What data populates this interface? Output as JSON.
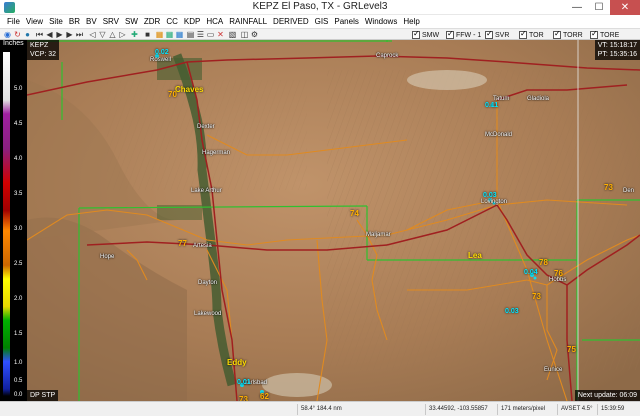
{
  "window": {
    "title": "KEPZ El Paso, TX - GRLevel3",
    "minimize": "—",
    "maximize": "☐",
    "close": "✕"
  },
  "menu": [
    "File",
    "View",
    "Site",
    "BR",
    "BV",
    "SRV",
    "SW",
    "ZDR",
    "CC",
    "KDP",
    "HCA",
    "RAINFALL",
    "DERIVED",
    "GIS",
    "Panels",
    "Windows",
    "Help"
  ],
  "toolbar": {
    "checks": [
      {
        "label": "SMW",
        "checked": true
      },
      {
        "label": "FFW - 1",
        "checked": true
      },
      {
        "label": "SVR",
        "checked": true
      },
      {
        "label": "TOR",
        "checked": true
      },
      {
        "label": "TORR",
        "checked": true
      },
      {
        "label": "TORE",
        "checked": true
      }
    ]
  },
  "legend": {
    "units": "Inches",
    "ticks": [
      "5.0",
      "4.5",
      "4.0",
      "3.5",
      "3.0",
      "2.5",
      "2.0",
      "1.5",
      "1.0",
      "0.5",
      "0.0"
    ]
  },
  "map": {
    "site": "KEPZ",
    "vcp": "VCP: 32",
    "vt": "VT: 15:18:17",
    "pt": "PT: 15:35:16",
    "product": "DP STP",
    "next_update": "Next update: 06:09",
    "towns": [
      "Roswell",
      "Caprock",
      "Tatum",
      "Gladiola",
      "McDonald",
      "Dexter",
      "Hagerman",
      "Lake Arthur",
      "Lovington",
      "Maljamar",
      "Artesia",
      "Hope",
      "Dayton",
      "Lakewood",
      "Hobbs",
      "Eunice",
      "Carlsbad",
      "Den"
    ],
    "counties": [
      "Chaves",
      "Lea",
      "Eddy"
    ],
    "highways": [
      "70",
      "77",
      "74",
      "73",
      "78",
      "73",
      "73",
      "76",
      "62",
      "75"
    ],
    "values": [
      "0.02",
      "0.11",
      "0.03",
      "0.03",
      "0.01",
      "0.04"
    ]
  },
  "status": {
    "range": "58.4° 184.4 nm",
    "coords": "33.44592, -103.55857",
    "scale": "171 meters/pixel",
    "avset": "AVSET 4.5°",
    "clock": "15:39:59"
  }
}
